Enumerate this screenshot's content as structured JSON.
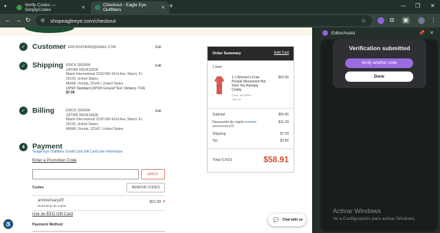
{
  "browser": {
    "tabs": [
      {
        "title": "Verify Codes — SimplyCodes",
        "favicon_color": "#3a9b3e"
      },
      {
        "title": "Checkout - Eagle Eye Outfitters",
        "favicon_color": "#2f7c66"
      }
    ],
    "url": "shopeagleeye.com/checkout"
  },
  "checkout": {
    "customer": {
      "title": "Customer",
      "email": "ERICKSP06089@GMAIL.COM",
      "edit": "Edit"
    },
    "shipping": {
      "title": "Shipping",
      "lines": [
        "ERICK SIERRA",
        "ZAT089 3503416838",
        "Miami International 2100 NW 42nd Ave, Miami, FL",
        "33142, United States",
        "MIAMI, Florida, 33142 / United States"
      ],
      "method": "UPS® Standard (UPS® Ground *Est. Delivery 7/14)",
      "price": "$7.09",
      "edit": "Edit"
    },
    "billing": {
      "title": "Billing",
      "lines": [
        "ERICK SIERRA",
        "ZAT089 3503416838",
        "Miami International 2100 NW 42nd Ave, Miami, FL",
        "33142, United States",
        "MIAMI, Florida, 33142 / United States"
      ],
      "edit": "Edit"
    },
    "payment": {
      "step": "4",
      "title": "Payment",
      "info_link": "*Eagle Eye Outfitters Credit Card Gift Card Use Information",
      "promo_link": "Enter a Promotion Code",
      "promo_placeholder": "",
      "apply": "APPLY",
      "codes_label": "Codes",
      "remove_codes": "REMOVE CODES",
      "code": "anniversary20",
      "code_sub": "Descuento de cupón",
      "code_amount": "-$11.99",
      "gift_card_link": "Use an EEO Gift Card",
      "method_label": "Payment Method"
    }
  },
  "summary": {
    "title": "Order Summary",
    "edit_cart": "Edit Cart",
    "item_count": "1 Item",
    "product": {
      "name_lines": [
        "1 x Women's Free",
        "People Movement Hot",
        "Shot Tee Romper",
        "Coddy"
      ],
      "color": "Color: 6202Pink",
      "size": "Size: M",
      "price": "$59.95"
    },
    "rows": [
      {
        "label": "Subtotal",
        "value": "$59.95"
      },
      {
        "label": "Descuento de cupón",
        "link": "remove",
        "sub": "anniversary20",
        "value": "-$11.99"
      },
      {
        "label": "Shipping",
        "value": "$7.09"
      },
      {
        "label": "Tax",
        "value": "$3.86"
      }
    ],
    "total_label": "Total (USD)",
    "total_value": "$58.91"
  },
  "chat": {
    "label": "Chat with us"
  },
  "panel": {
    "title": "EditorAssist",
    "popup_title": "Verification submitted",
    "verify_another": "Verify another code",
    "done": "Done"
  },
  "watermark": {
    "line1": "Activar Windows",
    "line2": "Ve a Configuración para activar Windows."
  },
  "colors": {
    "brand_green": "#1f4535",
    "total_orange": "#d0502e",
    "accent_purple": "#9a6be0"
  }
}
